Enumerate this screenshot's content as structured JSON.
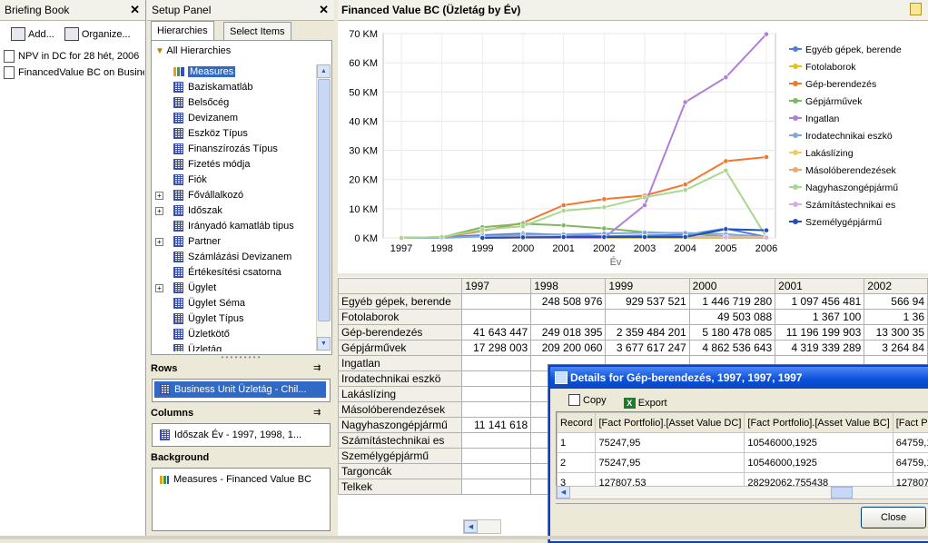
{
  "briefing_book": {
    "title": "Briefing Book",
    "add_label": "Add...",
    "organize_label": "Organize...",
    "items": [
      "NPV in DC for 28 hét, 2006",
      "FinancedValue BC on Busine"
    ]
  },
  "setup_panel": {
    "title": "Setup Panel",
    "tabs": [
      "Hierarchies",
      "Select Items"
    ],
    "all_hierarchies": "All Hierarchies",
    "tree": [
      "Measures",
      "Baziskamatláb",
      "Belsőcég",
      "Devizanem",
      "Eszköz Típus",
      "Finanszírozás Típus",
      "Fizetés módja",
      "Fiók",
      "Fővállalkozó",
      "Időszak",
      "Irányadó kamatláb tipus",
      "Partner",
      "Számlázási Devizanem",
      "Értékesítési csatorna",
      "Ügylet",
      "Ügylet Séma",
      "Ügylet Típus",
      "Üzletkötő",
      "Üzletág"
    ],
    "rows_label": "Rows",
    "rows_value": "Business Unit Üzletág - Chil...",
    "columns_label": "Columns",
    "columns_value": "Időszak Év - 1997, 1998, 1...",
    "background_label": "Background",
    "background_value": "Measures - Financed Value BC"
  },
  "main": {
    "title": "Financed Value BC (Üzletág by Év)"
  },
  "chart_data": {
    "type": "line",
    "title": "",
    "xlabel": "Év",
    "ylabel": "",
    "x": [
      "1997",
      "1998",
      "1999",
      "2000",
      "2001",
      "2002",
      "2003",
      "2004",
      "2005",
      "2006"
    ],
    "ylim": [
      0,
      70
    ],
    "y_ticks": [
      "0 KM",
      "10 KM",
      "20 KM",
      "30 KM",
      "40 KM",
      "50 KM",
      "60 KM",
      "70 KM"
    ],
    "grid": true,
    "legend_position": "right",
    "series": [
      {
        "name": "Egyéb gépek, berende",
        "color": "#4f7fd8",
        "values": [
          0,
          0.25,
          0.93,
          1.45,
          1.1,
          0.57,
          0.8,
          1.0,
          3.2,
          0.3
        ]
      },
      {
        "name": "Fotolaborok",
        "color": "#e8c020",
        "values": [
          null,
          null,
          null,
          0.05,
          0,
          0.01,
          0.01,
          0.01,
          0.01,
          0.01
        ]
      },
      {
        "name": "Gép-berendezés",
        "color": "#f07830",
        "values": [
          0.04,
          0.25,
          2.36,
          5.18,
          11.2,
          13.3,
          14.5,
          18.3,
          26.3,
          27.7
        ]
      },
      {
        "name": "Gépjárművek",
        "color": "#80b860",
        "values": [
          0.02,
          0.21,
          3.68,
          4.86,
          4.3,
          3.26,
          2.0,
          1.5,
          0.5,
          0.2
        ]
      },
      {
        "name": "Ingatlan",
        "color": "#b080d8",
        "values": [
          null,
          null,
          null,
          0,
          0,
          0,
          11.2,
          46.5,
          55.0,
          69.8
        ]
      },
      {
        "name": "Irodatechnikai eszkö",
        "color": "#80a8e0",
        "values": [
          0,
          0,
          0.5,
          1.0,
          1.2,
          1.5,
          1.8,
          1.7,
          1.3,
          0.3
        ]
      },
      {
        "name": "Lakáslízing",
        "color": "#e8d060",
        "values": [
          null,
          null,
          0,
          0,
          0.2,
          0.3,
          0.3,
          0.3,
          0.3,
          0.3
        ]
      },
      {
        "name": "Másolóberendezések",
        "color": "#f0a870",
        "values": [
          null,
          null,
          0,
          0.3,
          0.4,
          0.3,
          0.3,
          0.2,
          0.2,
          0.1
        ]
      },
      {
        "name": "Nagyhaszongépjármű",
        "color": "#a8d890",
        "values": [
          0.01,
          0.3,
          2.8,
          4.0,
          9.3,
          10.5,
          13.9,
          16.4,
          23.1,
          0.3
        ]
      },
      {
        "name": "Számítástechnikai es",
        "color": "#d0b0e8",
        "values": [
          null,
          null,
          0,
          0.1,
          0.2,
          0.2,
          0.2,
          0.2,
          0.2,
          0.1
        ]
      },
      {
        "name": "Személygépjármű",
        "color": "#1f4fb8",
        "values": [
          null,
          null,
          0,
          0.2,
          0.3,
          0.3,
          0.3,
          0.3,
          3.0,
          2.6
        ]
      }
    ]
  },
  "table": {
    "columns": [
      "1997",
      "1998",
      "1999",
      "2000",
      "2001",
      "2002"
    ],
    "rows": [
      {
        "label": "Egyéb gépek, berende",
        "values": [
          "",
          "248 508 976",
          "929 537 521",
          "1 446 719 280",
          "1 097 456 481",
          "566 94"
        ]
      },
      {
        "label": "Fotolaborok",
        "values": [
          "",
          "",
          "",
          "49 503 088",
          "1 367 100",
          "1 36"
        ]
      },
      {
        "label": "Gép-berendezés",
        "values": [
          "41 643 447",
          "249 018 395",
          "2 359 484 201",
          "5 180 478 085",
          "11 196 199 903",
          "13 300 35"
        ]
      },
      {
        "label": "Gépjárművek",
        "values": [
          "17 298 003",
          "209 200 060",
          "3 677 617 247",
          "4 862 536 643",
          "4 319 339 289",
          "3 264 84"
        ]
      },
      {
        "label": "Ingatlan",
        "values": [
          "",
          "",
          "",
          "",
          "",
          ""
        ]
      },
      {
        "label": "Irodatechnikai eszkö",
        "values": [
          "",
          "",
          "",
          "",
          "",
          ""
        ]
      },
      {
        "label": "Lakáslízing",
        "values": [
          "",
          "",
          "",
          "",
          "",
          ""
        ]
      },
      {
        "label": "Másolóberendezések",
        "values": [
          "",
          "",
          "",
          "",
          "",
          ""
        ]
      },
      {
        "label": "Nagyhaszongépjármű",
        "values": [
          "11 141 618",
          "",
          "",
          "",
          "",
          ""
        ]
      },
      {
        "label": "Számítástechnikai es",
        "values": [
          "",
          "",
          "",
          "",
          "",
          ""
        ]
      },
      {
        "label": "Személygépjármű",
        "values": [
          "",
          "",
          "",
          "",
          "",
          ""
        ]
      },
      {
        "label": "Targoncák",
        "values": [
          "",
          "",
          "",
          "",
          "",
          ""
        ]
      },
      {
        "label": "Telkek",
        "values": [
          "",
          "",
          "",
          "",
          "",
          ""
        ]
      }
    ]
  },
  "dialog": {
    "title": "Details for Gép-berendezés, 1997, 1997, 1997",
    "copy_label": "Copy",
    "export_label": "Export",
    "columns": [
      "Record",
      "[Fact Portfolio].[Asset Value DC]",
      "[Fact Portfolio].[Asset Value BC]",
      "[Fact Por"
    ],
    "rows": [
      [
        "1",
        "75247,95",
        "10546000,1925",
        "64759,19"
      ],
      [
        "2",
        "75247,95",
        "10546000,1925",
        "64759,19"
      ],
      [
        "3",
        "127807,53",
        "28292062,755438",
        "127807,5"
      ]
    ],
    "close_label": "Close"
  }
}
